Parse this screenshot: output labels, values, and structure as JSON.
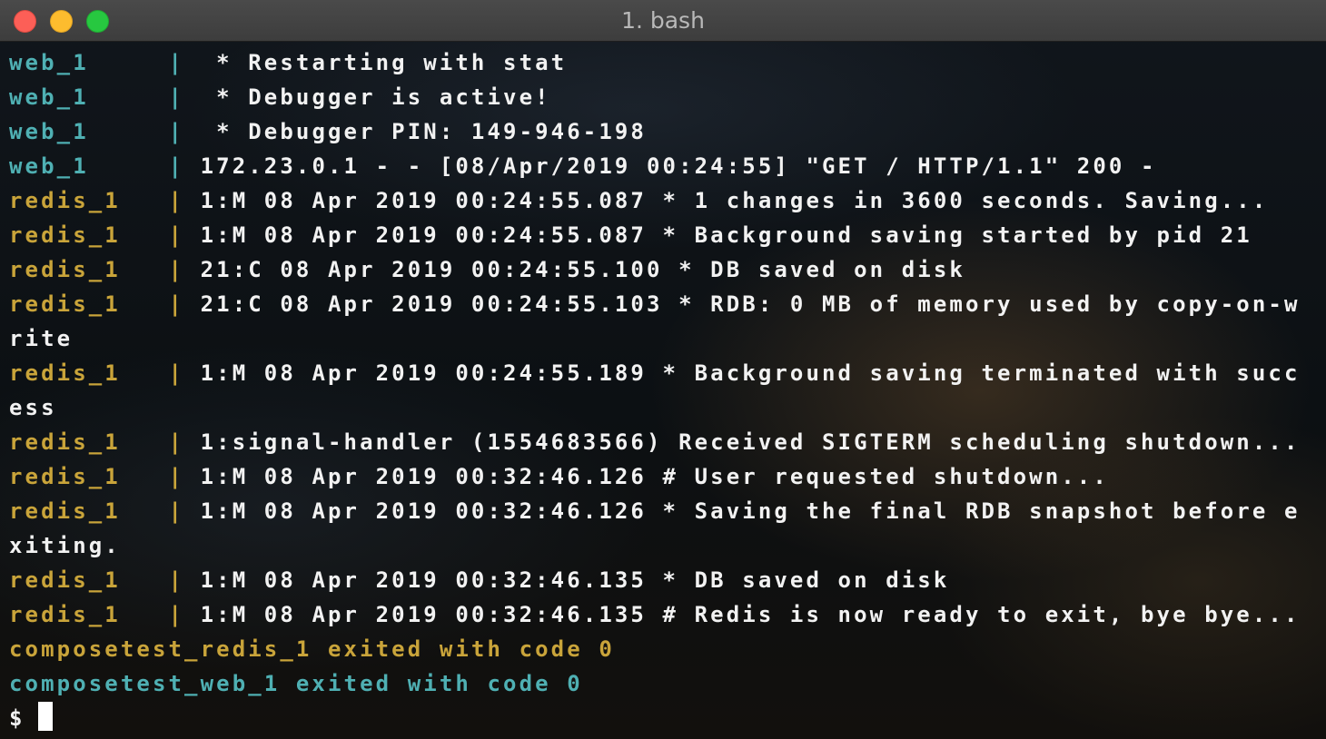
{
  "window": {
    "title": "1. bash",
    "colors": {
      "close": "#fc5f57",
      "minimize": "#fdbc2e",
      "zoom": "#27c840",
      "web_service": "#4fb0b3",
      "redis_service": "#c9a43a",
      "text": "#f2f2f2"
    }
  },
  "lines": [
    {
      "prefix": "web_1     | ",
      "text": " * Restarting with stat"
    },
    {
      "prefix": "web_1     | ",
      "text": " * Debugger is active!"
    },
    {
      "prefix": "web_1     | ",
      "text": " * Debugger PIN: 149-946-198"
    },
    {
      "prefix": "web_1     | ",
      "text": "172.23.0.1 - - [08/Apr/2019 00:24:55] \"GET / HTTP/1.1\" 200 -"
    },
    {
      "prefix": "redis_1   | ",
      "text": "1:M 08 Apr 2019 00:24:55.087 * 1 changes in 3600 seconds. Saving..."
    },
    {
      "prefix": "redis_1   | ",
      "text": "1:M 08 Apr 2019 00:24:55.087 * Background saving started by pid 21"
    },
    {
      "prefix": "redis_1   | ",
      "text": "21:C 08 Apr 2019 00:24:55.100 * DB saved on disk"
    },
    {
      "prefix": "redis_1   | ",
      "text": "21:C 08 Apr 2019 00:24:55.103 * RDB: 0 MB of memory used by copy-on-w"
    },
    {
      "prefix": "",
      "text": "rite"
    },
    {
      "prefix": "redis_1   | ",
      "text": "1:M 08 Apr 2019 00:24:55.189 * Background saving terminated with succ"
    },
    {
      "prefix": "",
      "text": "ess"
    },
    {
      "prefix": "redis_1   | ",
      "text": "1:signal-handler (1554683566) Received SIGTERM scheduling shutdown..."
    },
    {
      "prefix": "redis_1   | ",
      "text": "1:M 08 Apr 2019 00:32:46.126 # User requested shutdown..."
    },
    {
      "prefix": "redis_1   | ",
      "text": "1:M 08 Apr 2019 00:32:46.126 * Saving the final RDB snapshot before e"
    },
    {
      "prefix": "",
      "text": "xiting."
    },
    {
      "prefix": "redis_1   | ",
      "text": "1:M 08 Apr 2019 00:32:46.135 * DB saved on disk"
    },
    {
      "prefix": "redis_1   | ",
      "text": "1:M 08 Apr 2019 00:32:46.135 # Redis is now ready to exit, bye bye..."
    }
  ],
  "exits": [
    {
      "text": "composetest_redis_1 exited with code 0"
    },
    {
      "text": "composetest_web_1 exited with code 0"
    }
  ],
  "prompt": {
    "symbol": "$"
  }
}
